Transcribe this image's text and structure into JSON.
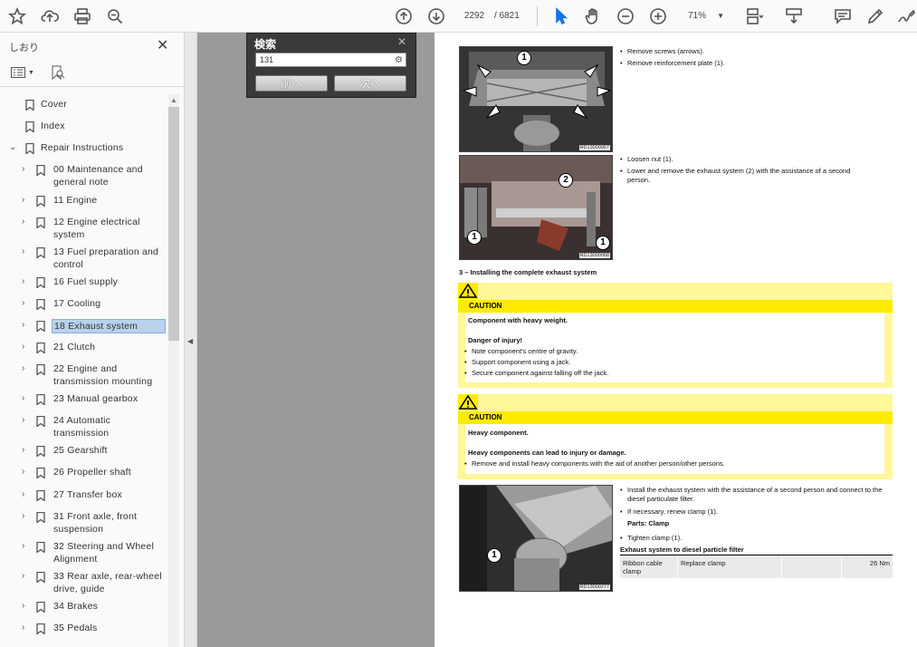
{
  "toolbar": {
    "page_current": "2292",
    "page_total": "/ 6821",
    "zoom": "71%"
  },
  "sidebar": {
    "title": "しおり",
    "items": [
      {
        "label": "Cover",
        "chevron": "",
        "level": 1
      },
      {
        "label": "Index",
        "chevron": "",
        "level": 1
      },
      {
        "label": "Repair Instructions",
        "chevron": "⌄",
        "level": 0
      },
      {
        "label": "00 Maintenance and general note",
        "chevron": "›",
        "level": 1
      },
      {
        "label": "11 Engine",
        "chevron": "›",
        "level": 1
      },
      {
        "label": "12 Engine electrical system",
        "chevron": "›",
        "level": 1
      },
      {
        "label": "13 Fuel preparation and control",
        "chevron": "›",
        "level": 1
      },
      {
        "label": "16 Fuel supply",
        "chevron": "›",
        "level": 1
      },
      {
        "label": "17 Cooling",
        "chevron": "›",
        "level": 1
      },
      {
        "label": "18 Exhaust system",
        "chevron": "›",
        "level": 1,
        "selected": true
      },
      {
        "label": "21 Clutch",
        "chevron": "›",
        "level": 1
      },
      {
        "label": "22 Engine and transmission mounting",
        "chevron": "›",
        "level": 1
      },
      {
        "label": "23 Manual gearbox",
        "chevron": "›",
        "level": 1
      },
      {
        "label": "24 Automatic transmission",
        "chevron": "›",
        "level": 1
      },
      {
        "label": "25 Gearshift",
        "chevron": "›",
        "level": 1
      },
      {
        "label": "26 Propeller shaft",
        "chevron": "›",
        "level": 1
      },
      {
        "label": "27 Transfer box",
        "chevron": "›",
        "level": 1
      },
      {
        "label": "31 Front axle, front suspension",
        "chevron": "›",
        "level": 1
      },
      {
        "label": "32 Steering and Wheel Alignment",
        "chevron": "›",
        "level": 1
      },
      {
        "label": "33 Rear axle, rear-wheel drive, guide",
        "chevron": "›",
        "level": 1
      },
      {
        "label": "34 Brakes",
        "chevron": "›",
        "level": 1
      },
      {
        "label": "35 Pedals",
        "chevron": "›",
        "level": 1
      }
    ]
  },
  "find": {
    "title": "検索",
    "query": "131",
    "prev_label": "前へ",
    "next_label": "次へ"
  },
  "page": {
    "photo1_id": "RD13000067",
    "photo2_id": "RD13000068",
    "photo3_id": "RD13000277",
    "step_remove_screws": "Remove screws (arrows).",
    "step_remove_plate": "Remove reinforcement plate (1).",
    "step_loosen_nut": "Loosen nut (1).",
    "step_lower_exhaust": "Lower and remove the exhaust system (2) with the assistance of a second person.",
    "section_heading": "3 – Installing the complete exhaust system",
    "caution1": {
      "label": "CAUTION",
      "heading": "Component with heavy weight.",
      "danger": "Danger of injury!",
      "points": [
        "Note component's centre of gravity.",
        "Support component using a jack.",
        "Secure component against falling off the jack."
      ]
    },
    "caution2": {
      "label": "CAUTION",
      "heading": "Heavy component.",
      "danger": "Heavy components can lead to injury or damage.",
      "points": [
        "Remove and install heavy components with the aid of another person/other persons."
      ]
    },
    "step_install": "Install the exhaust system with the assistance of a second person and connect to the diesel particulate filter.",
    "step_renew_clamp": "If necessary, renew clamp (1).",
    "parts_clamp": "Parts: Clamp",
    "step_tighten": "Tighten clamp (1).",
    "table_title": "Exhaust system to diesel particle filter",
    "table_row": {
      "col1": "Ribbon cable clamp",
      "col2": "Replace clamp",
      "col3": "",
      "col4": "26 Nm"
    },
    "callouts": {
      "c1": "1",
      "c2": "2"
    }
  }
}
